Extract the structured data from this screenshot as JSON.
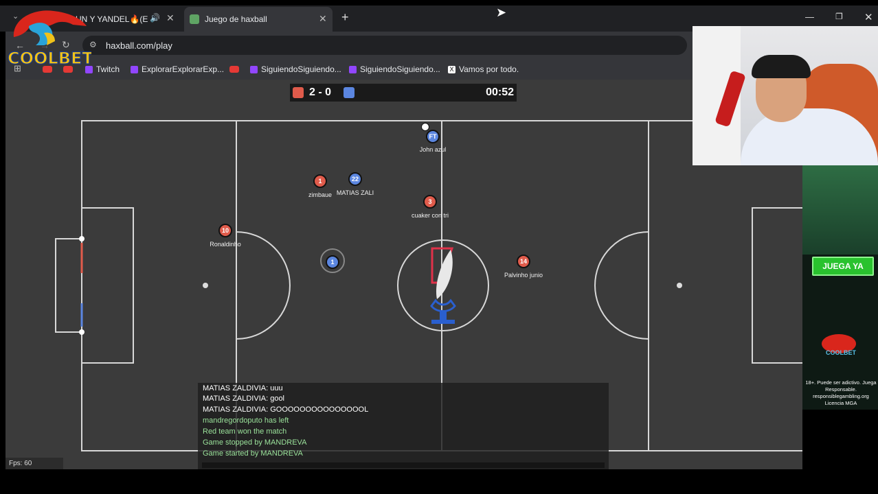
{
  "browser": {
    "tabs": [
      {
        "label": "UN Y YANDEL🔥(E"
      },
      {
        "label": "Juego de haxball"
      }
    ],
    "url": "haxball.com/play",
    "bookmarks": [
      "Twitch",
      "ExplorarExplorarExp...",
      "SiguiendoSiguiendo...",
      "SiguiendoSiguiendo...",
      "Vamos por todo."
    ]
  },
  "overlay_logo": {
    "text": "COOLBET"
  },
  "scoreboard": {
    "score": "2 - 0",
    "time": "00:52",
    "red_color": "#e05b4b",
    "blue_color": "#5b86e0"
  },
  "players": [
    {
      "number": "1",
      "name": "zimbaue",
      "team": "red"
    },
    {
      "number": "22",
      "name": "MATIAS ZALI",
      "team": "blue"
    },
    {
      "number": "3",
      "name": "cuaker con tri",
      "team": "red"
    },
    {
      "number": "10",
      "name": "Ronaldinho",
      "team": "red"
    },
    {
      "number": "1",
      "name": "",
      "team": "blue"
    },
    {
      "number": "14",
      "name": "Palvinho junio",
      "team": "red"
    },
    {
      "number": "FT",
      "name": "John  azul",
      "team": "blue"
    }
  ],
  "chat": {
    "lines": [
      {
        "text": "MATIAS ZALDIVIA: uuu",
        "kind": "user"
      },
      {
        "text": "MATIAS ZALDIVIA: gool",
        "kind": "user"
      },
      {
        "text": "MATIAS ZALDIVIA: GOOOOOOOOOOOOOOOL",
        "kind": "user"
      },
      {
        "text": "mandregordoputo has left",
        "kind": "system"
      },
      {
        "text": "Red team won the match",
        "kind": "system"
      },
      {
        "text": "Game stopped by MANDREVA",
        "kind": "system"
      },
      {
        "text": "Game started by MANDREVA",
        "kind": "system"
      }
    ]
  },
  "fps": "Fps: 60",
  "ad": {
    "button": "JUEGA YA",
    "brand": "COOLBET",
    "disclaimer": "18+. Puede ser adictivo. Juega Responsable. responsiblegambling.org Licencia MGA"
  }
}
